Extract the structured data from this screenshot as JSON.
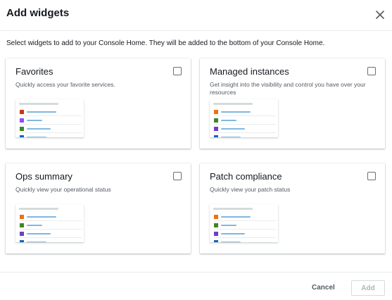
{
  "dialog": {
    "title": "Add widgets",
    "subtitle": "Select widgets to add to your Console Home. They will be added to the bottom of your Console Home."
  },
  "widgets": [
    {
      "title": "Favorites",
      "description": "Quickly access your favorite services.",
      "checked": false,
      "icon_colors": [
        "#d13212",
        "#8c4fff",
        "#3f8624",
        "#1166bb"
      ]
    },
    {
      "title": "Managed instances",
      "description": "Get insight into the visibility and control you have over your resources",
      "checked": false,
      "icon_colors": [
        "#ec7211",
        "#3f8624",
        "#6b40c4",
        "#1166bb"
      ]
    },
    {
      "title": "Ops summary",
      "description": "Quickly view your operational status",
      "checked": false,
      "icon_colors": [
        "#ec7211",
        "#3f8624",
        "#6b40c4",
        "#1166bb"
      ]
    },
    {
      "title": "Patch compliance",
      "description": "Quickly view your patch status",
      "checked": false,
      "icon_colors": [
        "#ec7211",
        "#3f8624",
        "#6b40c4",
        "#1166bb"
      ]
    }
  ],
  "footer": {
    "cancel_label": "Cancel",
    "add_label": "Add",
    "add_enabled": false
  }
}
